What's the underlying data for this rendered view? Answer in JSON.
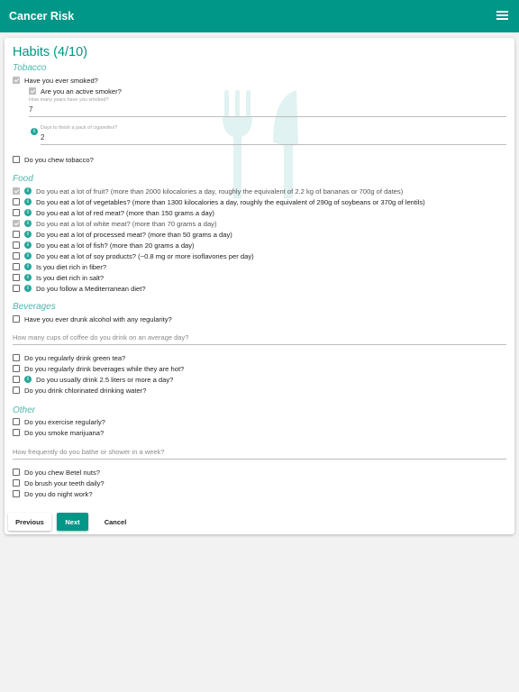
{
  "appbar": {
    "title": "Cancer Risk",
    "menu_icon": "hamburger-menu-icon"
  },
  "colors": {
    "primary": "#009688",
    "accent": "#26a69a",
    "section": "#4db6ac"
  },
  "page": {
    "heading": "Habits (4/10)"
  },
  "tobacco": {
    "title": "Tobacco",
    "ever_smoked": "Have you ever smoked?",
    "active_smoker": "Are you an active smoker?",
    "years_label": "How many years have you smoked?",
    "years_value": "7",
    "days_label": "Days to finish a pack of cigarettes?",
    "days_value": "2",
    "chew_tobacco": "Do you chew tobacco?"
  },
  "food": {
    "title": "Food",
    "items": [
      {
        "label": "Do you eat a lot of fruit? (more than 2000 kilocalories a day, roughly the equivalent of 2.2 kg of bananas or 700g of dates)",
        "checked": true
      },
      {
        "label": "Do you eat a lot of vegetables? (more than 1300 kilocalories a day, roughly the equivalent of 290g of soybeans or 370g of lentils)",
        "checked": false
      },
      {
        "label": "Do you eat a lot of red meat? (more than 150 grams a day)",
        "checked": false
      },
      {
        "label": "Do you eat a lot of white meat? (more than 70 grams a day)",
        "checked": true
      },
      {
        "label": "Do you eat a lot of processed meat? (more than 50 grams a day)",
        "checked": false
      },
      {
        "label": "Do you eat a lot of fish? (more than 20 grams a day)",
        "checked": false
      },
      {
        "label": "Do you eat a lot of soy products? (~0.8 mg or more isoflavones per day)",
        "checked": false
      },
      {
        "label": "Is you diet rich in fiber?",
        "checked": false
      },
      {
        "label": "Is you diet rich in salt?",
        "checked": false
      },
      {
        "label": "Do you follow a Mediterranean diet?",
        "checked": false
      }
    ]
  },
  "beverages": {
    "title": "Beverages",
    "alcohol": "Have you ever drunk alcohol with any regularity?",
    "coffee_placeholder": "How many cups of coffee do you drink on an average day?",
    "green_tea": "Do you regularly drink green tea?",
    "hot_drinks": "Do you regularly drink beverages while they are hot?",
    "water": "Do you usually drink 2.5 liters or more a day?",
    "chlorinated": "Do you drink chlorinated drinking water?"
  },
  "other": {
    "title": "Other",
    "exercise": "Do you exercise regularly?",
    "marijuana": "Do you smoke marijuana?",
    "bathe_placeholder": "How frequently do you bathe or shower in a week?",
    "betel": "Do you chew Betel nuts?",
    "brush": "Do brush your teeth daily?",
    "night_work": "Do you do night work?"
  },
  "buttons": {
    "previous": "Previous",
    "next": "Next",
    "cancel": "Cancel"
  }
}
